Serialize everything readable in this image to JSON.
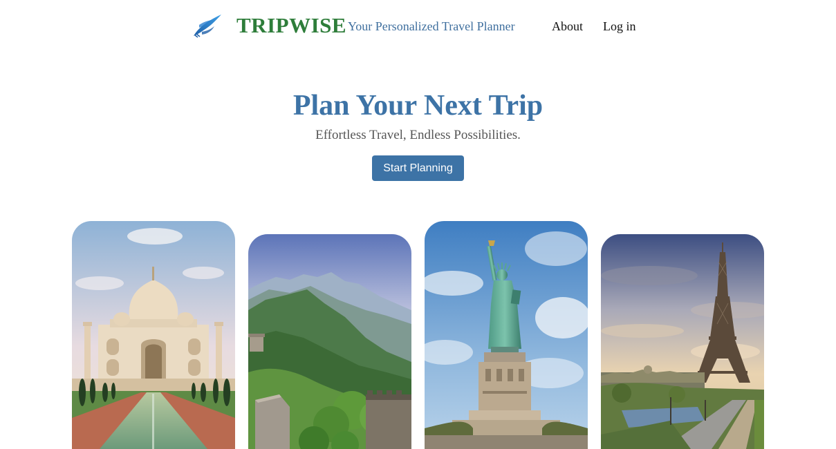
{
  "header": {
    "brand": "TRIPWISE",
    "tagline": "Your Personalized Travel Planner",
    "nav": {
      "about": "About",
      "login": "Log in"
    },
    "brand_color": "#2e7d3a",
    "accent_color": "#3d73a6"
  },
  "hero": {
    "title": "Plan Your Next Trip",
    "subtitle": "Effortless Travel, Endless Possibilities.",
    "cta_label": "Start Planning"
  },
  "destinations": [
    {
      "name": "Taj Mahal",
      "icon": "taj-mahal-image"
    },
    {
      "name": "Great Wall of China",
      "icon": "great-wall-image"
    },
    {
      "name": "Statue of Liberty",
      "icon": "statue-of-liberty-image"
    },
    {
      "name": "Eiffel Tower",
      "icon": "eiffel-tower-image"
    }
  ]
}
